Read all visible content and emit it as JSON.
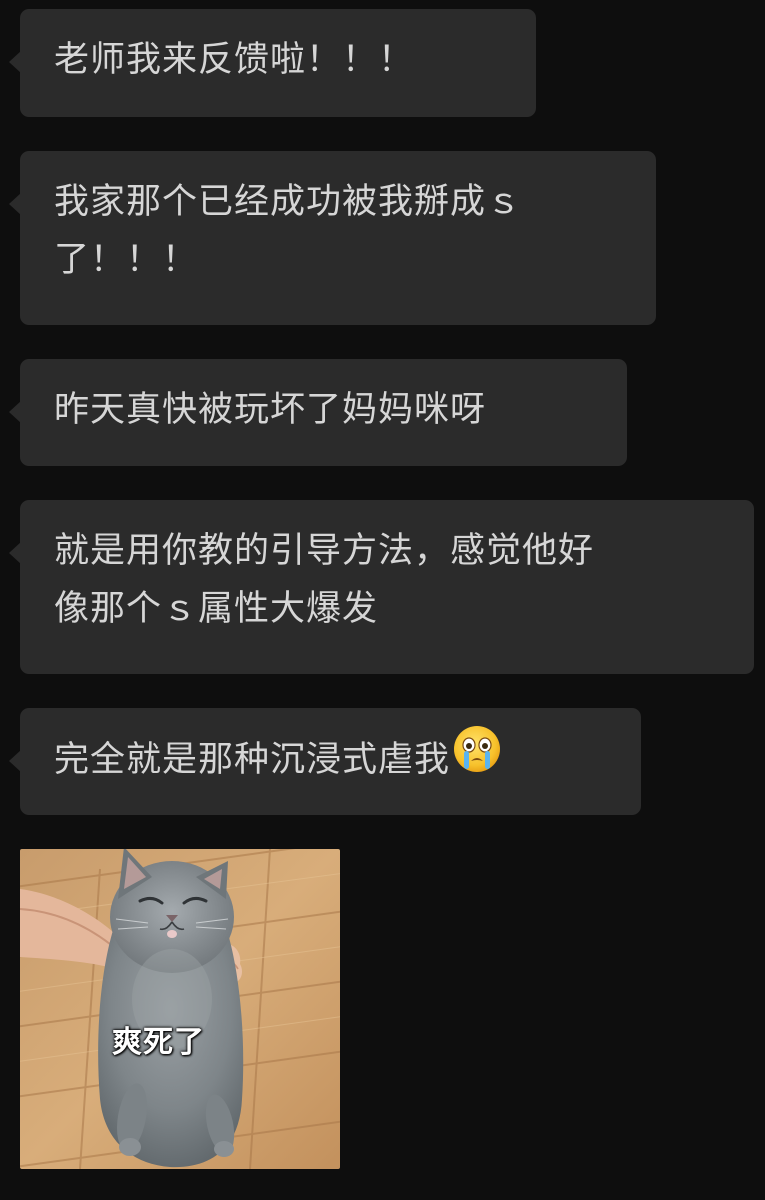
{
  "messages": [
    {
      "lines": [
        "老师我来反馈啦！！！"
      ]
    },
    {
      "lines": [
        "我家那个已经成功被我掰成ｓ",
        "了！！！"
      ]
    },
    {
      "lines": [
        "昨天真快被玩坏了妈妈咪呀"
      ]
    },
    {
      "lines": [
        "就是用你教的引导方法，感觉他好",
        "像那个ｓ属性大爆发"
      ]
    },
    {
      "lines": [
        "完全就是那种沉浸式虐我"
      ],
      "emoji": "crying-face-icon"
    }
  ],
  "sticker": {
    "caption": "爽死了",
    "subject": "grey cat lying on wooden floor"
  },
  "colors": {
    "background": "#0e0e0e",
    "bubble": "#2b2b2b",
    "text": "#d6d6d6"
  }
}
